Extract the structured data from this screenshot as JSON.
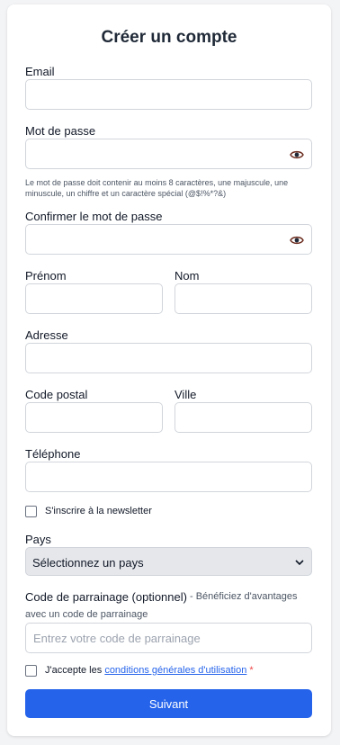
{
  "form": {
    "title": "Créer un compte",
    "email_label": "Email",
    "password_label": "Mot de passe",
    "password_hint": "Le mot de passe doit contenir au moins 8 caractères, une majuscule, une minuscule, un chiffre et un caractère spécial (@$!%*?&)",
    "confirm_label": "Confirmer le mot de passe",
    "firstname_label": "Prénom",
    "lastname_label": "Nom",
    "address_label": "Adresse",
    "postal_label": "Code postal",
    "city_label": "Ville",
    "phone_label": "Téléphone",
    "newsletter_label": "S'inscrire à la newsletter",
    "country_label": "Pays",
    "country_selected": "Sélectionnez un pays",
    "referral_label": "Code de parrainage (optionnel)",
    "referral_desc_1": "- Bénéficiez d'avantages",
    "referral_desc_2": "avec un code de parrainage",
    "referral_placeholder": "Entrez votre code de parrainage",
    "terms_prefix": "J'accepte les ",
    "terms_link": "conditions générales d'utilisation",
    "terms_required": " *",
    "submit_label": "Suivant"
  },
  "icons": {
    "password_toggle": "eye-icon",
    "confirm_toggle": "eye-icon",
    "select_arrow": "chevron-down-icon"
  },
  "colors": {
    "primary": "#2563eb",
    "required": "#ef4444",
    "border": "#d1d5db"
  }
}
